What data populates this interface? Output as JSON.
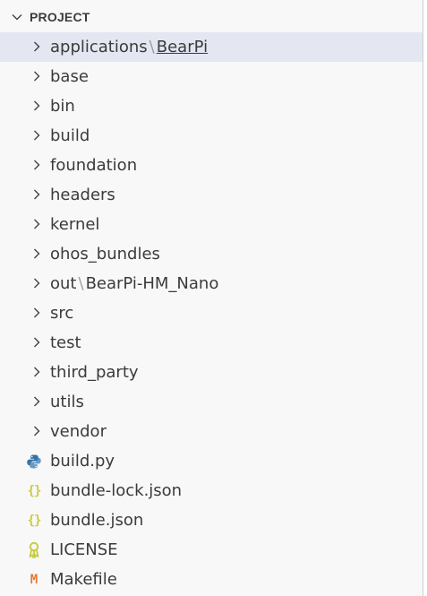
{
  "explorer": {
    "section_title": "PROJECT",
    "section_icon": "chevron-down-icon",
    "items": [
      {
        "kind": "folder",
        "label": "applications",
        "compact_suffix": "BearPi",
        "selected": true,
        "icon": "chevron-right-icon"
      },
      {
        "kind": "folder",
        "label": "base",
        "icon": "chevron-right-icon"
      },
      {
        "kind": "folder",
        "label": "bin",
        "icon": "chevron-right-icon"
      },
      {
        "kind": "folder",
        "label": "build",
        "icon": "chevron-right-icon"
      },
      {
        "kind": "folder",
        "label": "foundation",
        "icon": "chevron-right-icon"
      },
      {
        "kind": "folder",
        "label": "headers",
        "icon": "chevron-right-icon"
      },
      {
        "kind": "folder",
        "label": "kernel",
        "icon": "chevron-right-icon"
      },
      {
        "kind": "folder",
        "label": "ohos_bundles",
        "icon": "chevron-right-icon"
      },
      {
        "kind": "folder",
        "label": "out",
        "compact_suffix": "BearPi-HM_Nano",
        "icon": "chevron-right-icon"
      },
      {
        "kind": "folder",
        "label": "src",
        "icon": "chevron-right-icon"
      },
      {
        "kind": "folder",
        "label": "test",
        "icon": "chevron-right-icon"
      },
      {
        "kind": "folder",
        "label": "third_party",
        "icon": "chevron-right-icon"
      },
      {
        "kind": "folder",
        "label": "utils",
        "icon": "chevron-right-icon"
      },
      {
        "kind": "folder",
        "label": "vendor",
        "icon": "chevron-right-icon"
      },
      {
        "kind": "file",
        "label": "build.py",
        "icon": "python-icon"
      },
      {
        "kind": "file",
        "label": "bundle-lock.json",
        "icon": "json-icon",
        "icon_text": "{}"
      },
      {
        "kind": "file",
        "label": "bundle.json",
        "icon": "json-icon",
        "icon_text": "{}"
      },
      {
        "kind": "file",
        "label": "LICENSE",
        "icon": "license-icon"
      },
      {
        "kind": "file",
        "label": "Makefile",
        "icon": "makefile-icon",
        "icon_text": "M"
      }
    ]
  },
  "colors": {
    "panel_bg": "#f8f8f8",
    "selected_bg": "#e4e6f1",
    "text": "#3b3b3b",
    "separator": "#9e9e9e",
    "json_icon": "#cbcb41",
    "makefile_icon": "#e37933",
    "python_blue": "#3572a5",
    "python_yellow": "#f7c948",
    "license_icon": "#cbcb41"
  },
  "path_separator": "\\"
}
